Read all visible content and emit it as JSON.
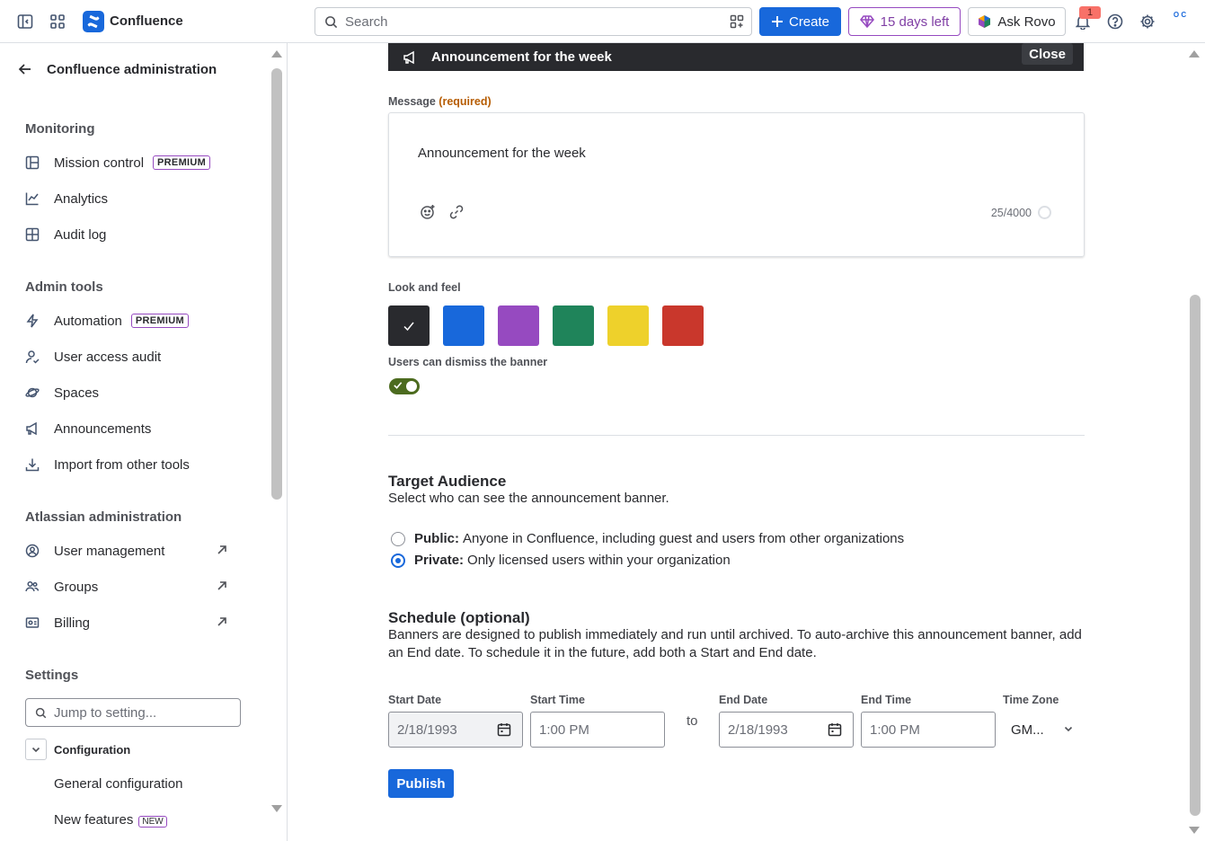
{
  "topnav": {
    "app_name": "Confluence",
    "search_placeholder": "Search",
    "create_label": "Create",
    "trial_label": "15 days left",
    "rovo_label": "Ask Rovo",
    "notification_count": "1",
    "avatar_text": "O C"
  },
  "sidebar": {
    "title": "Confluence administration",
    "monitoring": {
      "heading": "Monitoring",
      "items": [
        {
          "label": "Mission control",
          "badge": "PREMIUM"
        },
        {
          "label": "Analytics"
        },
        {
          "label": "Audit log"
        }
      ]
    },
    "admin_tools": {
      "heading": "Admin tools",
      "items": [
        {
          "label": "Automation",
          "badge": "PREMIUM"
        },
        {
          "label": "User access audit"
        },
        {
          "label": "Spaces"
        },
        {
          "label": "Announcements"
        },
        {
          "label": "Import from other tools"
        }
      ]
    },
    "atlassian_admin": {
      "heading": "Atlassian administration",
      "items": [
        {
          "label": "User management"
        },
        {
          "label": "Groups"
        },
        {
          "label": "Billing"
        }
      ]
    },
    "settings": {
      "heading": "Settings",
      "search_placeholder": "Jump to setting...",
      "configuration_label": "Configuration",
      "general_configuration": "General configuration",
      "new_features": "New features",
      "new_badge": "NEW"
    }
  },
  "main": {
    "banner_preview": {
      "text": "Announcement for the week",
      "close_label": "Close"
    },
    "message": {
      "label": "Message",
      "required": "(required)",
      "value": "Announcement for the week",
      "count": "25/4000"
    },
    "look_and_feel": {
      "label": "Look and feel",
      "colors": [
        "#292a2e",
        "#1868db",
        "#964ac0",
        "#1f845a",
        "#eed12b",
        "#c9372c"
      ],
      "selected_index": 0
    },
    "dismiss": {
      "label": "Users can dismiss the banner",
      "enabled": true
    },
    "target_audience": {
      "heading": "Target Audience",
      "description": "Select who can see the announcement banner.",
      "options": [
        {
          "title": "Public:",
          "text": "Anyone in Confluence, including guest and users from other organizations",
          "selected": false
        },
        {
          "title": "Private:",
          "text": "Only licensed users within your organization",
          "selected": true
        }
      ]
    },
    "schedule": {
      "heading": "Schedule (optional)",
      "description": "Banners are designed to publish immediately and run until archived. To auto-archive this announcement banner, add an End date. To schedule it in the future, add both a Start and End date.",
      "start_date_label": "Start Date",
      "start_date": "2/18/1993",
      "start_time_label": "Start Time",
      "start_time": "1:00 PM",
      "to_label": "to",
      "end_date_label": "End Date",
      "end_date": "2/18/1993",
      "end_time_label": "End Time",
      "end_time": "1:00 PM",
      "timezone_label": "Time Zone",
      "timezone": "GM..."
    },
    "publish_label": "Publish"
  }
}
